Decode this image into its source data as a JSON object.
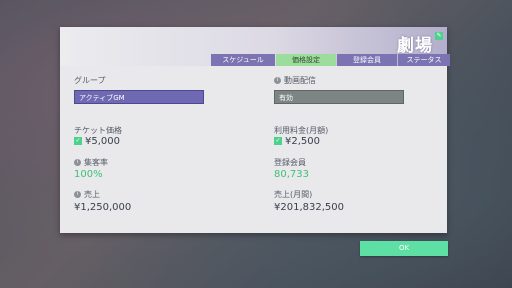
{
  "title": "劇場",
  "tabs": [
    {
      "label": "スケジュール",
      "active": false
    },
    {
      "label": "価格設定",
      "active": true
    },
    {
      "label": "登録会員",
      "active": false
    },
    {
      "label": "ステータス",
      "active": false
    }
  ],
  "left": {
    "group_label": "グループ",
    "group_value": "アクティブGM",
    "ticket_label": "チケット価格",
    "ticket_value": "¥5,000",
    "attendance_label": "集客率",
    "attendance_value": "100%",
    "sales_label": "売上",
    "sales_value": "¥1,250,000"
  },
  "right": {
    "stream_label": "動画配信",
    "stream_value": "有効",
    "fee_label": "利用料金(月額)",
    "fee_value": "¥2,500",
    "members_label": "登録会員",
    "members_value": "80,733",
    "monthly_sales_label": "売上(月間)",
    "monthly_sales_value": "¥201,832,500"
  },
  "ok_label": "OK",
  "colors": {
    "accent_green": "#5ee0a4",
    "tab_purple": "#7b73b2",
    "select_purple": "#6f68b2"
  }
}
